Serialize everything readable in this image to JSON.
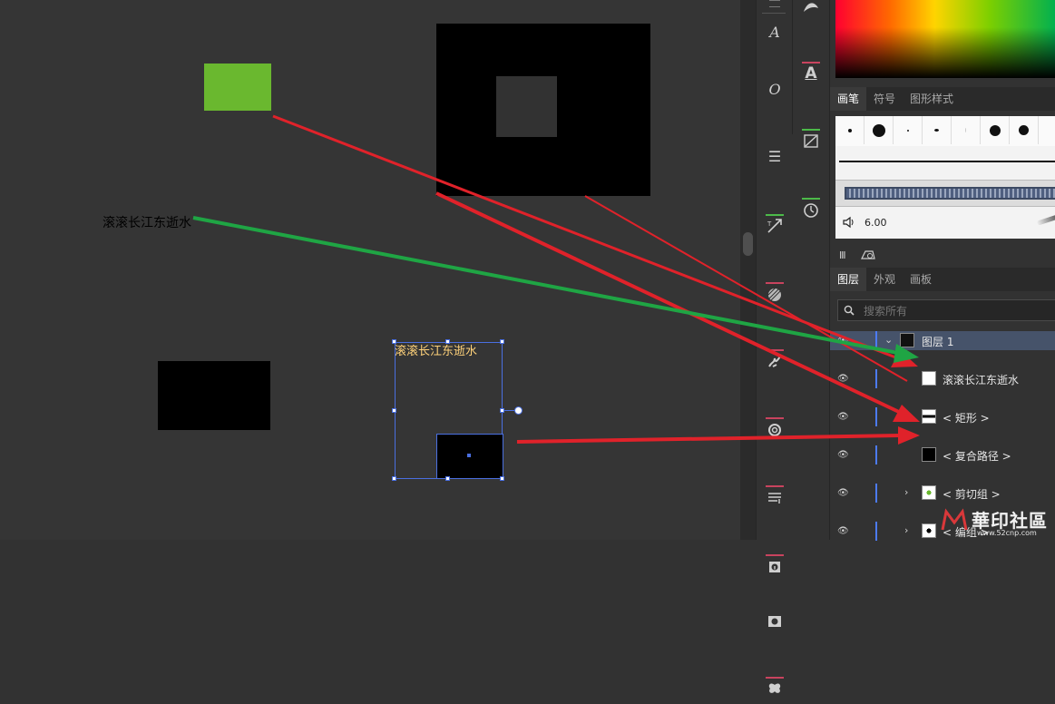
{
  "canvas": {
    "text_label": "滚滚长江东逝水",
    "selected_text_label": "滚滚长江东逝水",
    "colors": {
      "background": "#353535",
      "green_rect": "#6ab82f",
      "black": "#000000",
      "inner_gray": "#323232",
      "selection": "#4a6fe0",
      "arrow_red": "#e0222a",
      "arrow_green": "#1fa544"
    }
  },
  "tools": [
    {
      "icon": "brush-tip-icon"
    },
    {
      "icon": "text-style-a-icon",
      "glyph": "A"
    },
    {
      "icon": "text-style-o-icon",
      "glyph": "O"
    },
    {
      "icon": "menu-lines-icon",
      "glyph": "☰"
    },
    {
      "icon": "touch-type-icon"
    },
    {
      "icon": "hatch-icon"
    },
    {
      "icon": "splash-icon"
    },
    {
      "icon": "spiral-icon"
    },
    {
      "icon": "text-wrap-icon"
    },
    {
      "icon": "info-icon"
    },
    {
      "icon": "camera-icon"
    },
    {
      "icon": "butterfly-icon"
    }
  ],
  "tools2": [
    {
      "icon": "shape-tool-icon"
    },
    {
      "icon": "type-a-icon",
      "glyph": "A"
    },
    {
      "icon": "transform-icon"
    },
    {
      "icon": "clock-icon"
    }
  ],
  "brush_panel": {
    "tabs": [
      "画笔",
      "符号",
      "图形样式"
    ],
    "stroke_value": "6.00"
  },
  "layers_panel": {
    "tabs": [
      "图层",
      "外观",
      "画板"
    ],
    "search_placeholder": "搜索所有",
    "layer_name": "图层 1",
    "items": [
      {
        "label": "滚滚长江东逝水"
      },
      {
        "label": "< 矩形 >"
      },
      {
        "label": "< 复合路径 >"
      },
      {
        "label": "< 剪切组 >"
      },
      {
        "label": "< 编组 >"
      }
    ]
  },
  "watermark": {
    "text": "華印社區",
    "url": "www.52cnp.com"
  }
}
